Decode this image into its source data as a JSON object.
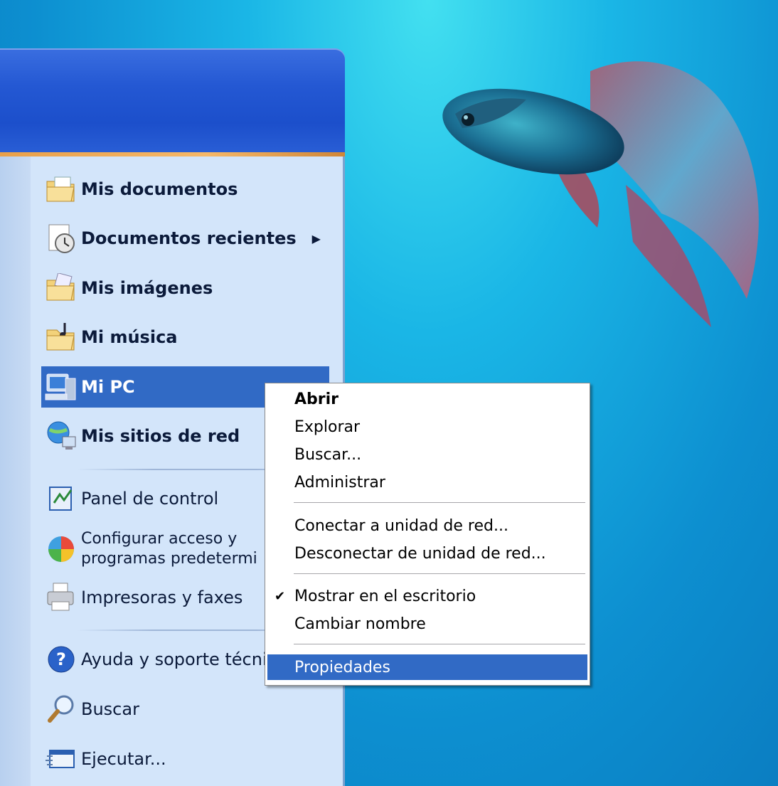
{
  "start_menu": {
    "items": [
      {
        "label": "Mis documentos",
        "icon": "my-documents-folder-icon",
        "bold": true
      },
      {
        "label": "Documentos recientes",
        "icon": "recent-documents-icon",
        "bold": true,
        "submenu_arrow": "▶"
      },
      {
        "label": "Mis imágenes",
        "icon": "my-pictures-folder-icon",
        "bold": true
      },
      {
        "label": "Mi música",
        "icon": "my-music-folder-icon",
        "bold": true
      },
      {
        "label": "Mi PC",
        "icon": "my-computer-icon",
        "bold": true,
        "highlighted": true
      },
      {
        "label": "Mis sitios de red",
        "icon": "network-places-icon",
        "bold": true
      },
      {
        "label": "Panel de control",
        "icon": "control-panel-icon"
      },
      {
        "label": "Configurar acceso y programas predetermi",
        "icon": "default-programs-icon"
      },
      {
        "label": "Impresoras y faxes",
        "icon": "printer-icon"
      },
      {
        "label": "Ayuda y soporte técni",
        "icon": "help-icon"
      },
      {
        "label": "Buscar",
        "icon": "search-icon"
      },
      {
        "label": "Ejecutar...",
        "icon": "run-icon"
      }
    ]
  },
  "context_menu": {
    "items": [
      {
        "label": "Abrir",
        "bold": true
      },
      {
        "label": "Explorar"
      },
      {
        "label": "Buscar..."
      },
      {
        "label": "Administrar"
      },
      {
        "label": "Conectar a unidad de red..."
      },
      {
        "label": "Desconectar de unidad de red..."
      },
      {
        "label": "Mostrar en el escritorio",
        "checked": true,
        "check_glyph": "✔"
      },
      {
        "label": "Cambiar nombre"
      },
      {
        "label": "Propiedades",
        "highlighted": true
      }
    ]
  },
  "colors": {
    "highlight": "#316ac5",
    "panel_bg": "#d3e5fa",
    "header_blue": "#2458d3"
  }
}
